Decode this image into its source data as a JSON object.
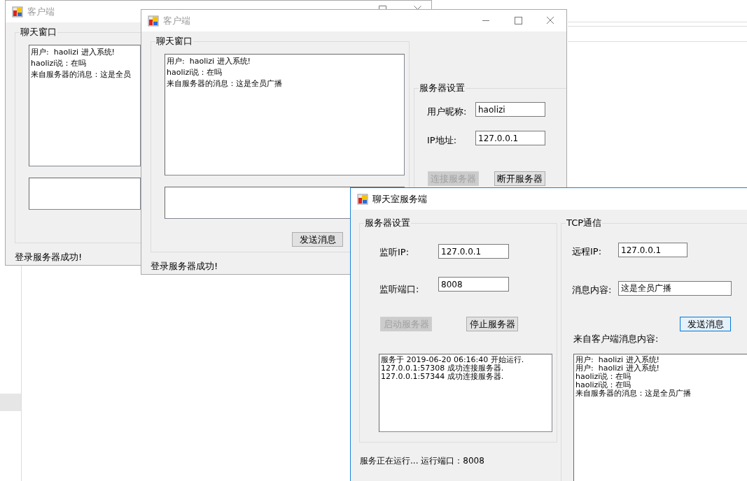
{
  "windows": [
    {
      "kind": "client",
      "title": "客户端",
      "active": false,
      "chat_group": {
        "title": "聊天窗口",
        "lines": [
          "用户:  haolizi 进入系统!",
          "haolizi说：在吗",
          "来自服务器的消息：这是全员"
        ]
      },
      "status": "登录服务器成功!"
    },
    {
      "kind": "client",
      "title": "客户端",
      "active": false,
      "chat_group": {
        "title": "聊天窗口",
        "lines": [
          "用户:  haolizi 进入系统!",
          "haolizi说：在吗",
          "来自服务器的消息：这是全员广播"
        ]
      },
      "send_button": "发送消息",
      "settings": {
        "title": "服务器设置",
        "fields": [
          {
            "label": "用户昵称:",
            "value": "haolizi"
          },
          {
            "label": "IP地址:",
            "value": "127.0.0.1"
          }
        ],
        "buttons": [
          {
            "label": "连接服务器",
            "disabled": true
          },
          {
            "label": "断开服务器",
            "disabled": false
          }
        ]
      },
      "status": "登录服务器成功!"
    },
    {
      "kind": "server",
      "title": "聊天室服务端",
      "active": true,
      "settings": {
        "title": "服务器设置",
        "fields": [
          {
            "label": "监听IP:",
            "value": "127.0.0.1"
          },
          {
            "label": "监听端口:",
            "value": "8008"
          }
        ],
        "buttons": [
          {
            "label": "启动服务器",
            "disabled": true
          },
          {
            "label": "停止服务器",
            "disabled": false
          }
        ],
        "log": [
          "服务于 2019-06-20 06:16:40 开始运行.",
          "127.0.0.1:57308 成功连接服务器.",
          "127.0.0.1:57344 成功连接服务器."
        ]
      },
      "status": "服务正在运行... 运行端口：8008",
      "tcp": {
        "title": "TCP通信",
        "fields": [
          {
            "label": "远程IP:",
            "value": "127.0.0.1"
          },
          {
            "label": "消息内容:",
            "value": "这是全员广播"
          }
        ],
        "send_button": "发送消息",
        "received_label": "来自客户端消息内容:",
        "received": [
          "用户:  haolizi 进入系统!",
          "用户:  haolizi 进入系统!",
          "haolizi说：在吗",
          "haolizi说：在吗",
          "来自服务器的消息：这是全员广播"
        ]
      }
    }
  ]
}
